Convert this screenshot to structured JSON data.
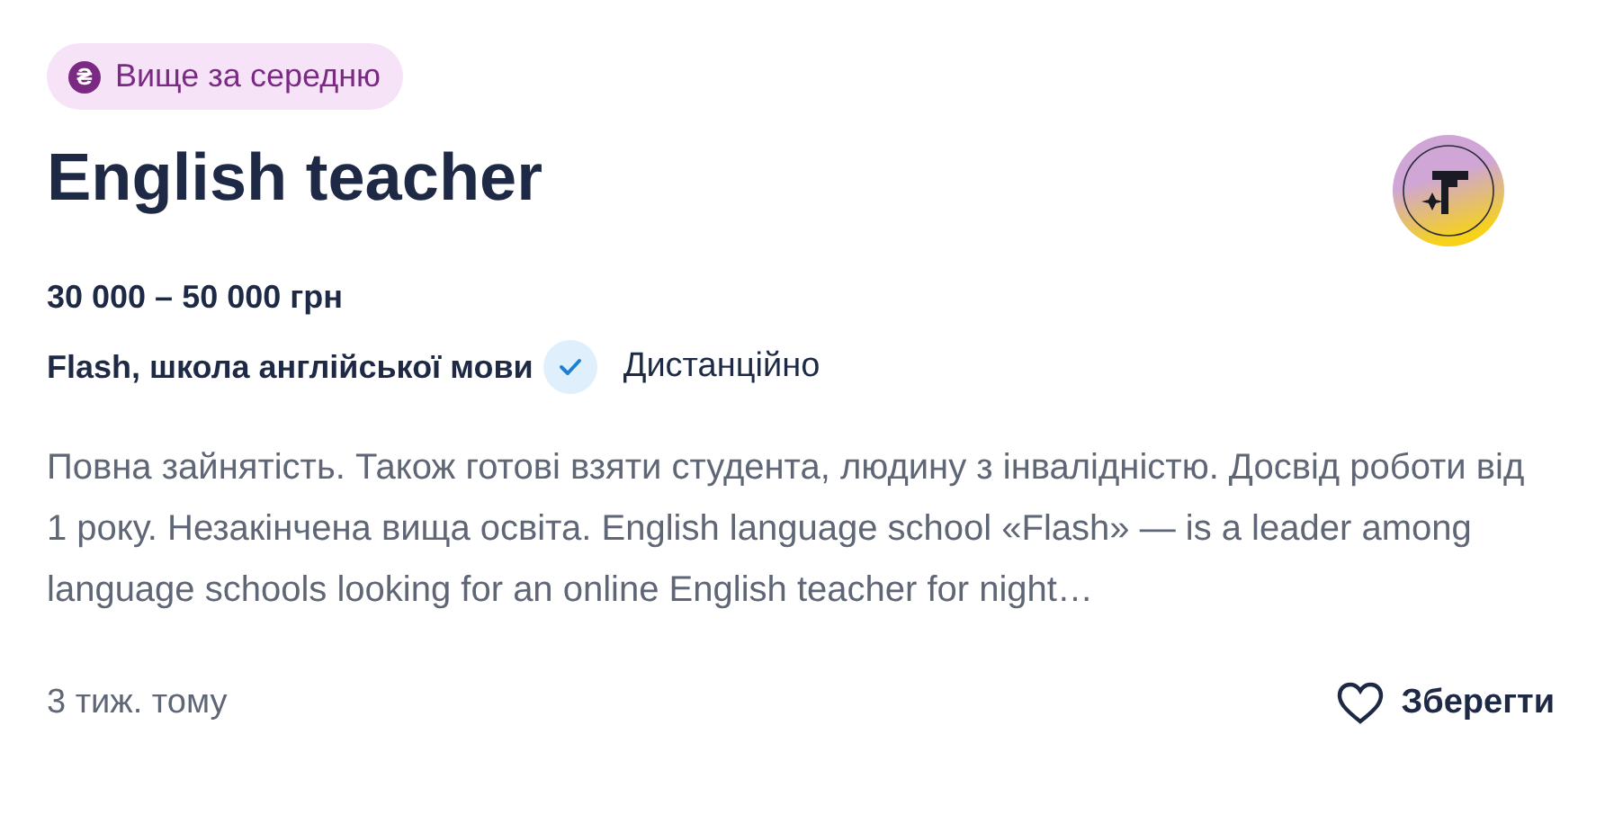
{
  "badge": {
    "icon": "₴",
    "label": "Вище за середню"
  },
  "title": "English teacher",
  "salary": "30 000 – 50 000 грн",
  "company": {
    "name": "Flash, школа англійської мови",
    "verified": true
  },
  "work_mode": "Дистанційно",
  "description": "Повна зайнятість. Також готові взяти студента, людину з інвалідністю. Досвід роботи від 1 року. Незакінчена вища освіта. English language school «Flash» — is a leader among language schools looking for an online English teacher for night…",
  "posted": "3 тиж. тому",
  "save_button": {
    "label": "Зберегти",
    "saved": false
  }
}
